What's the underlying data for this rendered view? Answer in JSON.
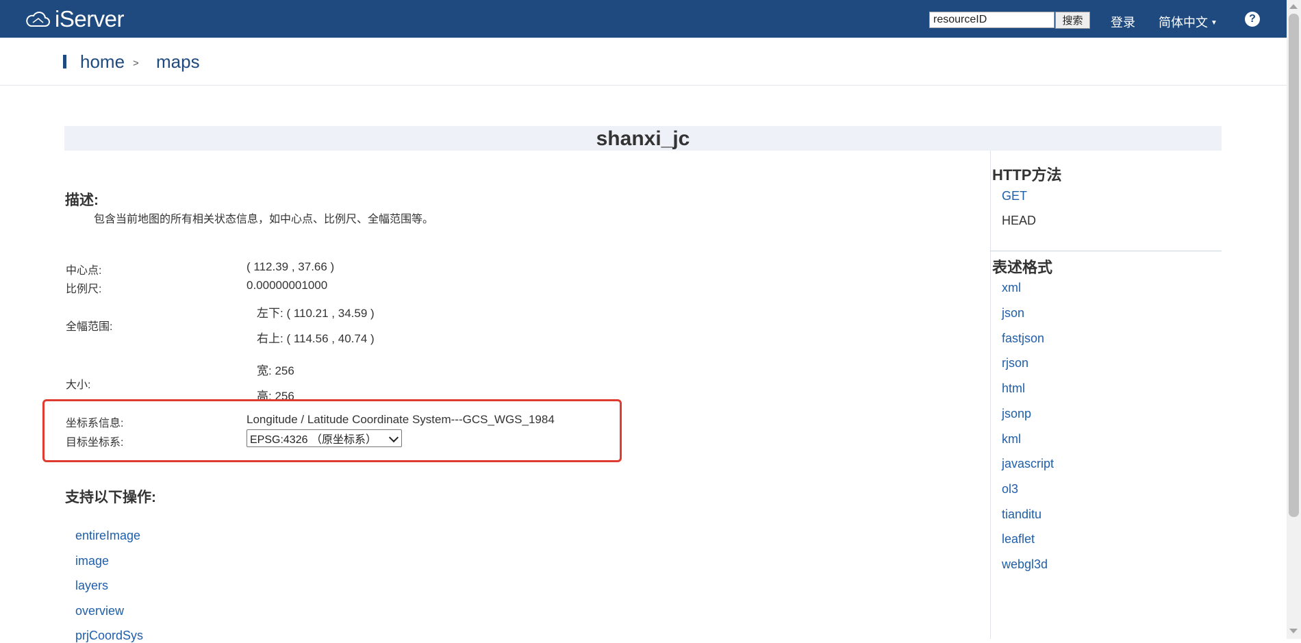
{
  "header": {
    "logo_text": "iServer",
    "search_value": "resourceID",
    "search_button": "搜索",
    "login": "登录",
    "language": "简体中文",
    "help_icon": "help-icon",
    "bg_color": "#1e4a7f"
  },
  "breadcrumb": {
    "home": "home",
    "separator": ">",
    "current": "maps"
  },
  "page_title": "shanxi_jc",
  "description": {
    "heading": "描述:",
    "text": "包含当前地图的所有相关状态信息，如中心点、比例尺、全幅范围等。"
  },
  "properties": {
    "center_label": "中心点:",
    "center_value": "( 112.39 , 37.66 )",
    "scale_label": "比例尺:",
    "scale_value": "0.00000001000",
    "bounds_label": "全幅范围:",
    "bounds_lower_left": "左下:  ( 110.21 , 34.59 )",
    "bounds_upper_right": "右上:  ( 114.56 , 40.74 )",
    "size_label": "大小:",
    "size_width": "宽:  256",
    "size_height": "高:  256",
    "crs_label": "坐标系信息:",
    "crs_value": "Longitude / Latitude Coordinate System---GCS_WGS_1984",
    "target_crs_label": "目标坐标系:",
    "target_crs_selected": "EPSG:4326 （原坐标系）"
  },
  "operations": {
    "heading": "支持以下操作:",
    "items": [
      "entireImage",
      "image",
      "layers",
      "overview",
      "prjCoordSys"
    ]
  },
  "sidebar": {
    "http_heading": "HTTP方法",
    "http_methods": [
      "GET",
      "HEAD"
    ],
    "format_heading": "表述格式",
    "formats": [
      "xml",
      "json",
      "fastjson",
      "rjson",
      "html",
      "jsonp",
      "kml",
      "javascript",
      "ol3",
      "tianditu",
      "leaflet",
      "webgl3d"
    ]
  }
}
